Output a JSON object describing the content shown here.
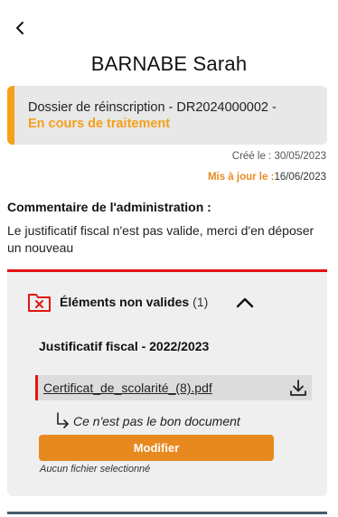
{
  "header": {
    "back_icon": "chevron-left-icon",
    "person_name": "BARNABE Sarah"
  },
  "dossier": {
    "title": "Dossier de réinscription - DR2024000002 -",
    "status": "En cours de traitement",
    "status_color": "#f5a01a"
  },
  "meta": {
    "created_label": "Créé le :",
    "created_date": "30/05/2023",
    "updated_label": "Mis à jour le :",
    "updated_date": "16/06/2023",
    "updated_color": "#e8891f"
  },
  "admin": {
    "heading": "Commentaire de l'administration :",
    "comment": "Le justificatif fiscal n'est pas valide, merci d'en déposer un nouveau"
  },
  "invalid_panel": {
    "icon": "folder-error-icon",
    "title": "Éléments non valides",
    "count": "(1)",
    "accent_color": "#e31414",
    "toggle_icon": "chevron-up-icon",
    "document_title": "Justificatif fiscal - 2022/2023",
    "file_name": "Certificat_de_scolarité_(8).pdf",
    "download_icon": "download-icon",
    "reject_reason": "Ce n'est pas le bon document",
    "reason_icon": "reply-arrow-icon",
    "modify_label": "Modifier",
    "modify_color": "#e8891f",
    "no_file_text": "Aucun fichier selectionné"
  }
}
